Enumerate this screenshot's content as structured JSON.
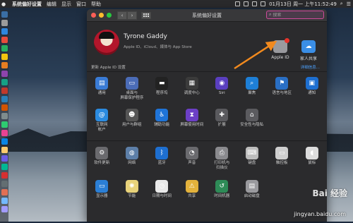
{
  "menubar": {
    "app": "系统偏好设置",
    "items": [
      "编辑",
      "显示",
      "窗口",
      "帮助"
    ],
    "clock": "01月13日 周一 上午11:52:49"
  },
  "window": {
    "title": "系统偏好设置",
    "search": {
      "placeholder": "搜索",
      "value": ""
    }
  },
  "account": {
    "name": "Tyrone Gaddy",
    "subtitle": "Apple ID、iCloud、媒体与 App Store",
    "apple_id_label": "Apple ID",
    "family_label": "家人共享"
  },
  "update": {
    "left": "更新 Apple ID 设置",
    "right": "详细信息..."
  },
  "rows": [
    [
      {
        "label": "通用",
        "icon": "general-icon",
        "color": "#3a7bd5",
        "glyph": "▤"
      },
      {
        "label": "桌面与\n屏幕保护程序",
        "icon": "desktop-icon",
        "color": "#4b6cb7",
        "glyph": "▭"
      },
      {
        "label": "程序坞",
        "icon": "dock-icon",
        "color": "#222",
        "glyph": "▬"
      },
      {
        "label": "调度中心",
        "icon": "mission-control-icon",
        "color": "#3b3b3b",
        "glyph": "▦"
      },
      {
        "label": "Siri",
        "icon": "siri-icon",
        "color": "#5a3fbf",
        "glyph": "◉"
      },
      {
        "label": "聚焦",
        "icon": "spotlight-icon",
        "color": "#1e7fd6",
        "glyph": "⌕"
      },
      {
        "label": "语言与地区",
        "icon": "language-icon",
        "color": "#2a6fc4",
        "glyph": "⚑"
      },
      {
        "label": "通知",
        "icon": "notifications-icon",
        "color": "#1e6fd0",
        "glyph": "▣"
      }
    ],
    [
      {
        "label": "互联网\n帐户",
        "icon": "internet-accounts-icon",
        "color": "#2b8be0",
        "glyph": "@"
      },
      {
        "label": "用户与群组",
        "icon": "users-icon",
        "color": "#555",
        "glyph": "☻"
      },
      {
        "label": "辅助功能",
        "icon": "accessibility-icon",
        "color": "#1f74d8",
        "glyph": "♿"
      },
      {
        "label": "屏幕使用时间",
        "icon": "screen-time-icon",
        "color": "#6c3fc6",
        "glyph": "⧗"
      },
      {
        "label": "扩展",
        "icon": "extensions-icon",
        "color": "#5a5a5e",
        "glyph": "✚"
      },
      {
        "label": "安全性与隐私",
        "icon": "security-icon",
        "color": "#5b5b5f",
        "glyph": "⌂"
      },
      {
        "label": "",
        "icon": "",
        "color": "",
        "glyph": ""
      },
      {
        "label": "",
        "icon": "",
        "color": "",
        "glyph": ""
      }
    ],
    [
      {
        "label": "软件更新",
        "icon": "software-update-icon",
        "color": "#6a6a6e",
        "glyph": "⚙"
      },
      {
        "label": "网络",
        "icon": "network-icon",
        "color": "#5d7fa8",
        "glyph": "◍"
      },
      {
        "label": "蓝牙",
        "icon": "bluetooth-icon",
        "color": "#1e6fd0",
        "glyph": "ᛒ"
      },
      {
        "label": "声音",
        "icon": "sound-icon",
        "color": "#6a6a6e",
        "glyph": "◔"
      },
      {
        "label": "打印机与\n扫描仪",
        "icon": "printer-icon",
        "color": "#8a8a8e",
        "glyph": "⎙"
      },
      {
        "label": "键盘",
        "icon": "keyboard-icon",
        "color": "#bdbdbd",
        "glyph": "⌨"
      },
      {
        "label": "触控板",
        "icon": "trackpad-icon",
        "color": "#cfcfcf",
        "glyph": "▭"
      },
      {
        "label": "鼠标",
        "icon": "mouse-icon",
        "color": "#dcdcdc",
        "glyph": "◖"
      }
    ],
    [
      {
        "label": "显示器",
        "icon": "display-icon",
        "color": "#2b7fd6",
        "glyph": "▭"
      },
      {
        "label": "节能",
        "icon": "energy-saver-icon",
        "color": "#e8d27a",
        "glyph": "✺"
      },
      {
        "label": "日期与时间",
        "icon": "date-time-icon",
        "color": "#e9e9e9",
        "glyph": "◷"
      },
      {
        "label": "共享",
        "icon": "sharing-icon",
        "color": "#e3b23c",
        "glyph": "⚠"
      },
      {
        "label": "时间机器",
        "icon": "time-machine-icon",
        "color": "#2e8b57",
        "glyph": "↺"
      },
      {
        "label": "启动磁盘",
        "icon": "startup-disk-icon",
        "color": "#9a9a9e",
        "glyph": "▤"
      },
      {
        "label": "",
        "icon": "",
        "color": "",
        "glyph": ""
      },
      {
        "label": "",
        "icon": "",
        "color": "",
        "glyph": ""
      }
    ]
  ],
  "watermark": {
    "text": "Bai 经验",
    "url": "jingyan.baidu.com"
  },
  "colors": {
    "accent": "#d04a9b",
    "arrow": "#f28a1e",
    "badge": "#e6342b"
  }
}
